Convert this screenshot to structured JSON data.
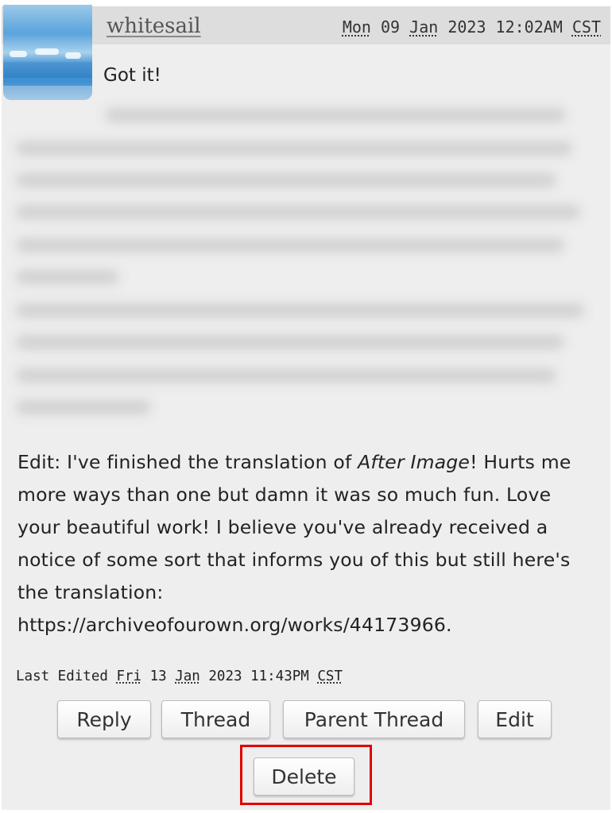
{
  "comment": {
    "username": "whitesail",
    "date": {
      "day": "Mon",
      "rest": "09",
      "month": "Jan",
      "year_time": "2023 12:02AM",
      "tz": "CST"
    },
    "first_line": "Got it!",
    "edit": {
      "before": "Edit: I've finished the translation of ",
      "title": "After Image",
      "after": "! Hurts me more ways than one but damn it was so much fun. Love your beautiful work! I believe you've already received a notice of some sort that informs you of this but still here's the translation: https://archiveofourown.org/works/44173966."
    },
    "last_edited": {
      "label": "Last Edited",
      "day": "Fri",
      "date": "13",
      "month": "Jan",
      "year_time": "2023 11:43PM",
      "tz": "CST"
    }
  },
  "actions": {
    "reply": "Reply",
    "thread": "Thread",
    "parent_thread": "Parent Thread",
    "edit": "Edit",
    "delete": "Delete"
  },
  "colors": {
    "highlight": "#e00000",
    "header_bg": "#dddddd",
    "comment_bg": "#eeeeee"
  },
  "icons": {
    "avatar": "sky-and-sea-avatar"
  }
}
